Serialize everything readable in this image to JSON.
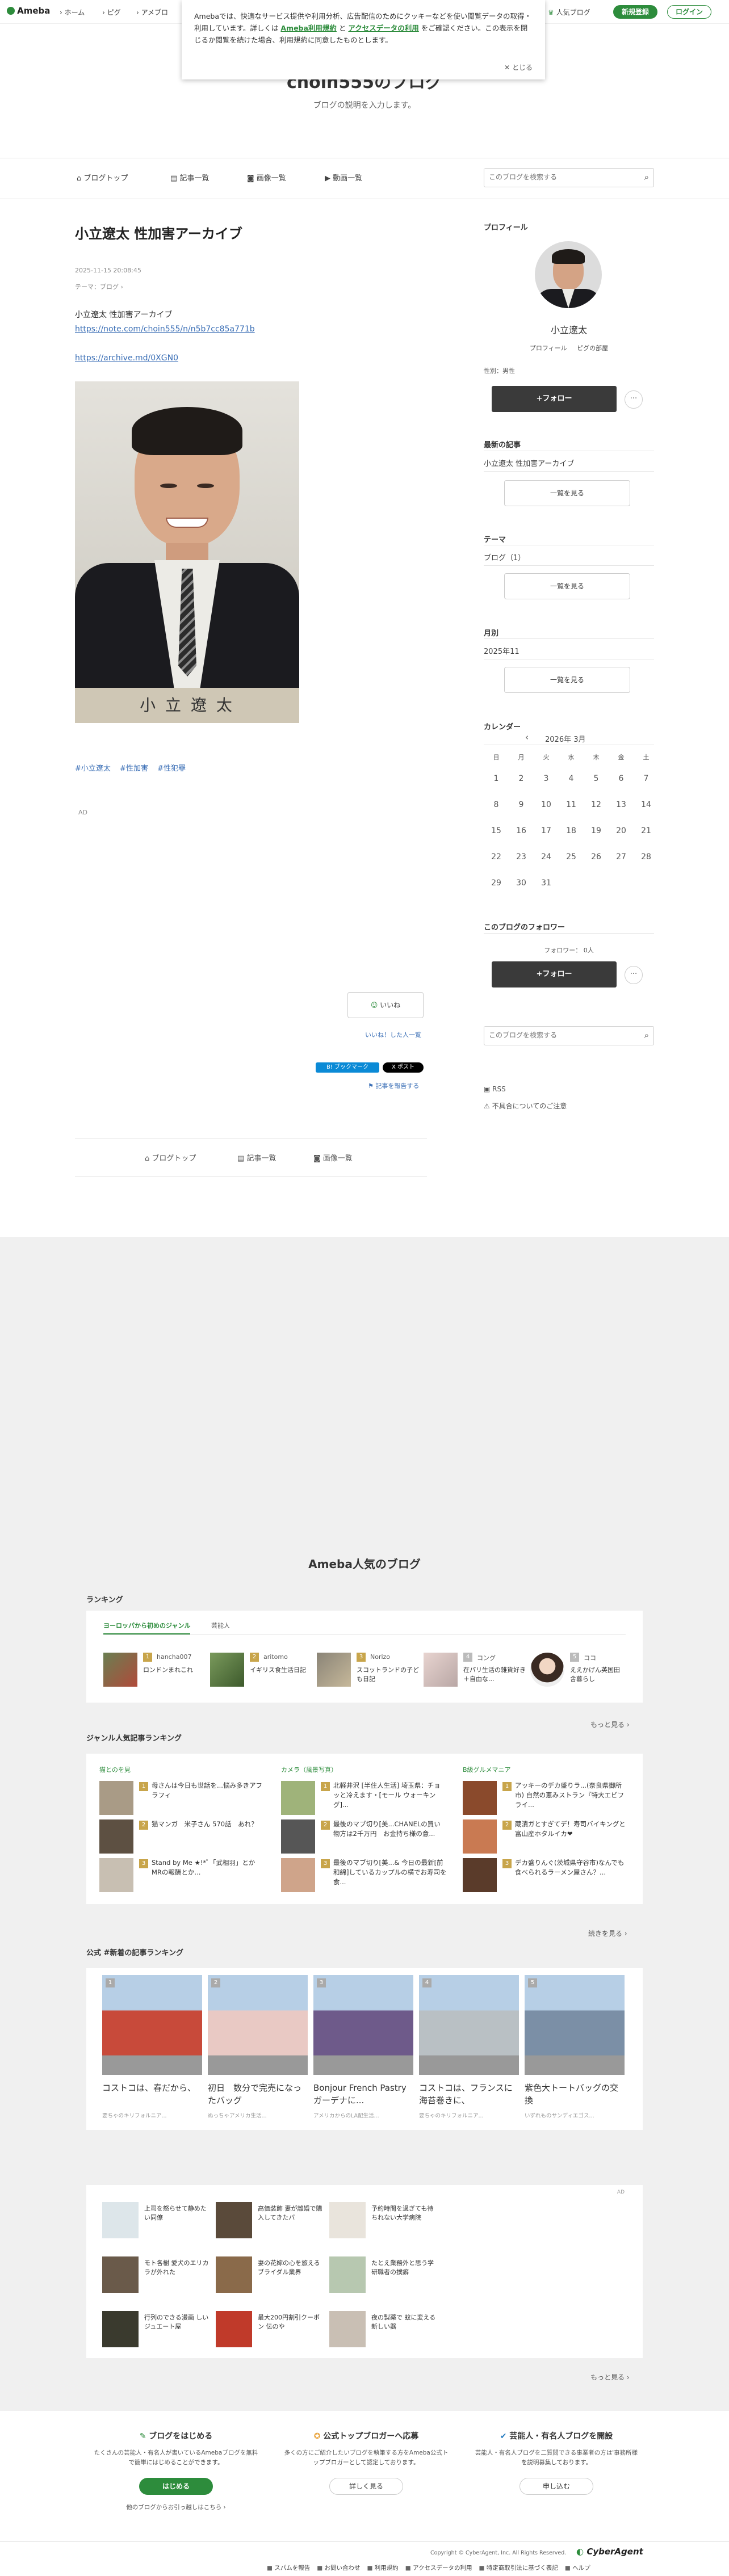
{
  "header": {
    "logo": "Ameba",
    "nav": [
      "ホーム",
      "ピグ",
      "アメブロ"
    ],
    "popular_blog": "人気ブログ",
    "signup": "新規登録",
    "login": "ログイン"
  },
  "cookie_notice": {
    "text1": "Amebaでは、快適なサービス提供や利用分析、広告配信のためにクッキーなどを使い閲覧データの取得・利用しています。詳しくは",
    "link1": "Ameba利用規約",
    "and": "と",
    "link2": "アクセスデータの利用",
    "text2": "をご確認ください。この表示を閉じるか閲覧を続けた場合、利用規約に同意したものとします。",
    "close": "とじる"
  },
  "blog": {
    "title": "choin555のブログ",
    "description": "ブログの説明を入力します。"
  },
  "blog_nav": {
    "items": [
      "ブログトップ",
      "記事一覧",
      "画像一覧",
      "動画一覧"
    ],
    "search_placeholder": "このブログを検索する"
  },
  "article": {
    "title": "小立遼太 性加害アーカイブ",
    "date": "2025-11-15 20:08:45",
    "theme": "テーマ：ブログ",
    "body_line": "小立遼太 性加害アーカイブ",
    "link1": "https://note.com/choin555/n/n5b7cc85a771b",
    "link2": "https://archive.md/0XGN0",
    "photo_caption": "小 立 遼 太",
    "hashtags": [
      "#小立遼太",
      "#性加害",
      "#性犯罪"
    ],
    "ad": "AD",
    "like": "いいね",
    "like_list": "いいね！した人一覧",
    "share_hatena": "B! ブックマーク",
    "share_x": "X ポスト",
    "report": "記事を報告する",
    "bottom_nav": [
      "ブログトップ",
      "記事一覧",
      "画像一覧"
    ]
  },
  "sidebar": {
    "profile_heading": "プロフィール",
    "profile_name": "小立遼太",
    "profile_link1": "プロフィール",
    "profile_link2": "ピグの部屋",
    "gender": "性別：男性",
    "follow": "+フォロー",
    "latest_heading": "最新の記事",
    "latest_item": "小立遼太 性加害アーカイブ",
    "list_button": "一覧を見る",
    "theme_heading": "テーマ",
    "theme_item": "ブログ（1）",
    "monthly_heading": "月別",
    "monthly_item": "2025年11",
    "calendar_heading": "カレンダー",
    "calendar_month": "2026年 3月",
    "weekdays": [
      "日",
      "月",
      "火",
      "水",
      "木",
      "金",
      "土"
    ],
    "weeks": [
      [
        "1",
        "2",
        "3",
        "4",
        "5",
        "6",
        "7"
      ],
      [
        "8",
        "9",
        "10",
        "11",
        "12",
        "13",
        "14"
      ],
      [
        "15",
        "16",
        "17",
        "18",
        "19",
        "20",
        "21"
      ],
      [
        "22",
        "23",
        "24",
        "25",
        "26",
        "27",
        "28"
      ],
      [
        "29",
        "30",
        "31",
        "",
        "",
        "",
        ""
      ]
    ],
    "follower_heading": "このブログのフォロワー",
    "follower_count": "フォロワー： 0人",
    "rss": "RSS",
    "report_issue": "不具合についてのご注意"
  },
  "popular": {
    "heading": "Ameba人気のブログ",
    "ranking_heading": "ランキング",
    "tabs": [
      "ヨーロッパから初めのジャンル",
      "芸能人"
    ],
    "ranking_items": [
      {
        "rank": "1",
        "name": "hancha007",
        "text": "ロンドンまれこれ"
      },
      {
        "rank": "2",
        "name": "aritomo",
        "text": "イギリス食生活日記"
      },
      {
        "rank": "3",
        "name": "Norizo",
        "text": "スコットランドの子ども日記"
      },
      {
        "rank": "4",
        "name": "コング",
        "text": "在パリ生活の雑貨好き＋自由な..."
      },
      {
        "rank": "5",
        "name": "ココ",
        "text": "ええかげん英国田舎暮らし"
      }
    ],
    "more": "もっと見る",
    "genre_heading": "ジャンル人気記事ランキング",
    "genres": [
      {
        "name": "猫とのを見",
        "items": [
          "母さんは今日も世話を...悩み多きアフラフィ",
          "猫マンガ　米子さん 570話　あれ？",
          "Stand by Me ★!*ﾟ「武相羽」とかMRの報酬とか..."
        ]
      },
      {
        "name": "カメラ（風景写真）",
        "items": [
          "北軽井沢 [半住人生活] 埼玉県：チョッと冷えます・[モール ウォーキング]...",
          "最後のマブ切り[美...CHANELの買い物方は2千万円　お金持ち様の意...",
          "最後のマブ切り[美...& 今日の最新[前和綿]しているカップルの横でお寿司を食..."
        ]
      },
      {
        "name": "B級グルメマニア",
        "items": [
          "アッキーのデカ盛りラ...(奈良県御所市) 自然の恵みストラン『特大エビフライ...",
          "蔵漬ガとすぎてデ！寿司バイキングと富山産ホタルイカ❤",
          "デカ盛りんぐ(茨城県守谷市)なんでも食べられるラーメン屋さん？..."
        ]
      }
    ],
    "more2": "続きを見る",
    "official_heading": "公式 #新着の記事ランキング",
    "official_items": [
      {
        "rank": "1",
        "title": "コストコは、春だから、",
        "sub": "要ちゃのキリフォルニア..."
      },
      {
        "rank": "2",
        "title": "初日　数分で完売になったバッグ",
        "sub": "ぬっちゃアメリカ生活..."
      },
      {
        "rank": "3",
        "title": "Bonjour French Pastry　ガーデナに...",
        "sub": "アメリカからのLA配生活..."
      },
      {
        "rank": "4",
        "title": "コストコは、フランスに海苔巻きに、",
        "sub": "要ちゃのキリフォルニア..."
      },
      {
        "rank": "5",
        "title": "紫色大トートバッグの交換",
        "sub": "いずれものサンディエゴス..."
      }
    ]
  },
  "ad_block": {
    "label": "AD",
    "items": [
      "上司を怒らせて静めたい同僚",
      "高価装飾 妻が離婚で購入してきたバ",
      "予約時間を過ぎても待ちれない大学病院",
      "モト各樹 愛犬のエリカラが外れた",
      "妻の花嫁の心を旅えるブライダル業界",
      "たとえ業務外と思う学研職者の撲癖",
      "行列のできる漫画 しいジュエート屋",
      "最大200円割引クーポン 伝のや",
      "夜の製薬で 蚊に変える新しい器"
    ],
    "more": "もっと見る"
  },
  "footer_promo": {
    "cols": [
      {
        "title": "ブログをはじめる",
        "desc": "たくさんの芸能人・有名人が書いているAmebaブログを無料で簡単にはじめることができます。",
        "button": "はじめる",
        "extra": "他のブログからお引っ越しはこちら"
      },
      {
        "title": "公式トップブロガーへ応募",
        "desc": "多くの方にご紹介したいブログを執筆する方をAmeba公式トップブロガーとして認定しております。",
        "button": "詳しく見る"
      },
      {
        "title": "芸能人・有名人ブログを開設",
        "desc": "芸能人・有名人ブログを二質問できる事業者の方は'事務所様を説明募集しております。",
        "button": "申し込む"
      }
    ]
  },
  "footer": {
    "copyright": "Copyright © CyberAgent, Inc. All Rights Reserved.",
    "brand": "CyberAgent",
    "links": [
      "スパムを報告",
      "お問い合わせ",
      "利用規約",
      "アクセスデータの利用",
      "特定商取引法に基づく表記",
      "ヘルプ"
    ]
  }
}
